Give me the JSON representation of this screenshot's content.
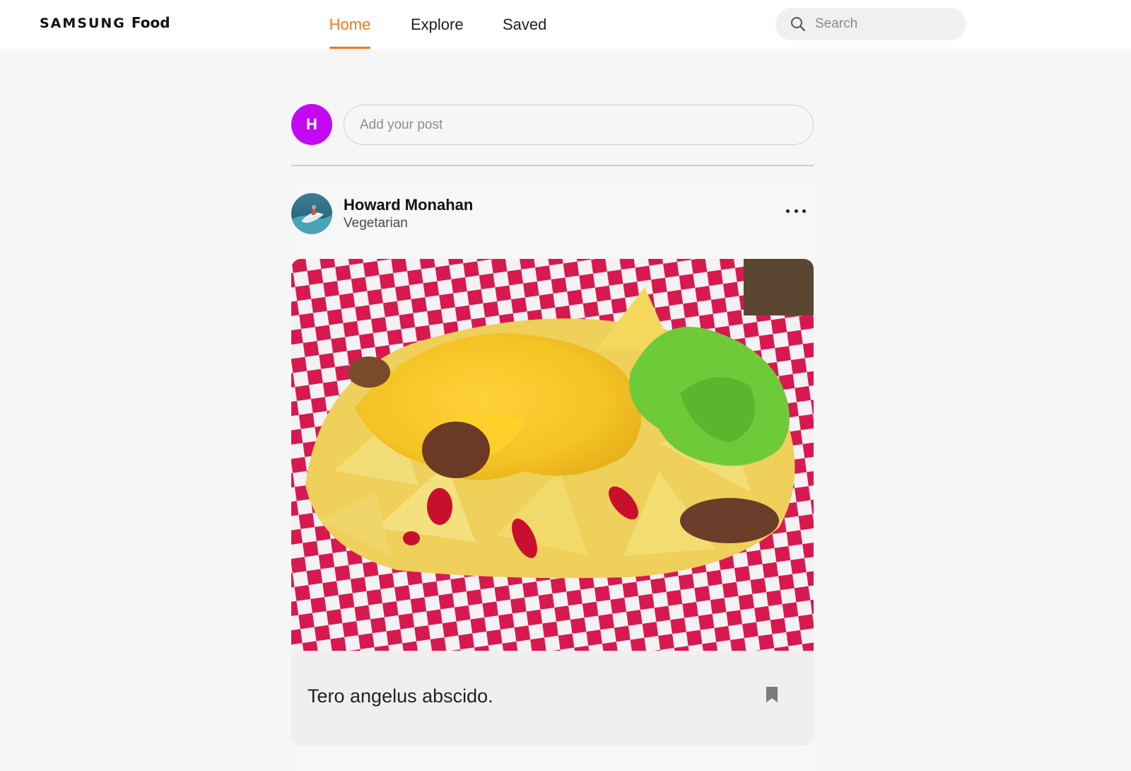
{
  "brand": {
    "samsung": "SAMSUNG",
    "food": "Food"
  },
  "nav": {
    "tabs": [
      {
        "label": "Home",
        "active": true
      },
      {
        "label": "Explore",
        "active": false
      },
      {
        "label": "Saved",
        "active": false
      }
    ],
    "search": {
      "placeholder": "Search",
      "value": ""
    }
  },
  "composer": {
    "avatar_initial": "H",
    "avatar_color": "#c309f2",
    "placeholder": "Add your post"
  },
  "post": {
    "author_name": "Howard Monahan",
    "author_tag": "Vegetarian",
    "image_alt": "nachos",
    "caption": "Tero angelus abscido.",
    "icons": {
      "menu": "more-horizontal-icon",
      "bookmark": "bookmark-icon",
      "search": "search-icon"
    }
  },
  "colors": {
    "accent": "#f2761e",
    "background": "#f6f6f6",
    "caption_bg": "#f0eeee"
  }
}
